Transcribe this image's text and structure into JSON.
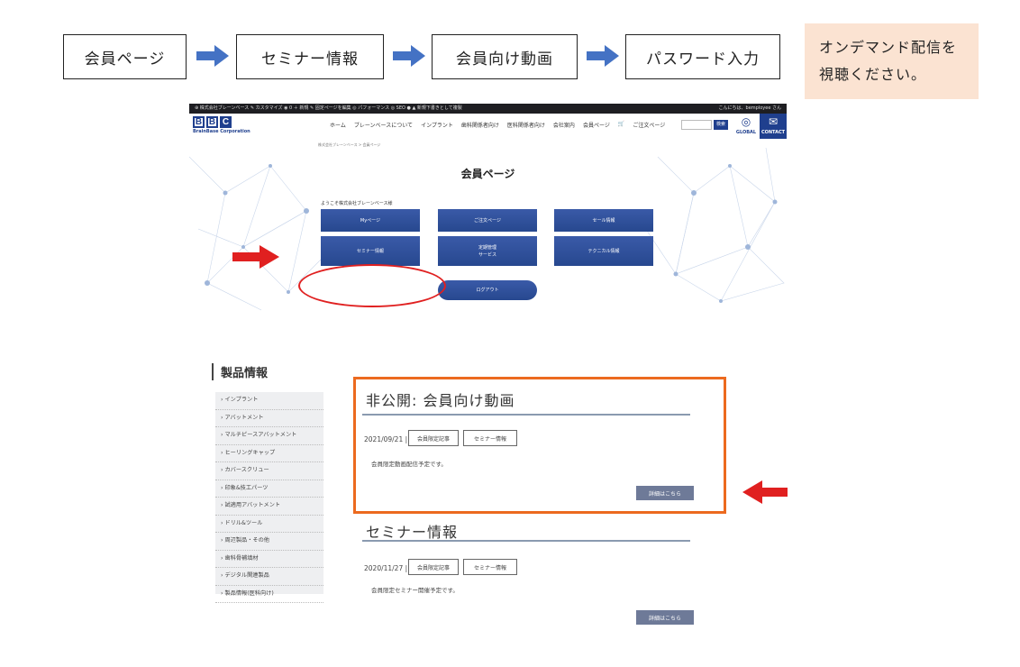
{
  "flow": {
    "steps": [
      "会員ページ",
      "セミナー情報",
      "会員向け動画",
      "パスワード入力"
    ],
    "note": [
      "オンデマンド配信を",
      "視聴ください。"
    ]
  },
  "site": {
    "adminbar_left": "⊕ 株式会社ブレーンベース ✎ カスタマイズ ◉ 0 ＋ 新規 ✎ 固定ページを編集 ◎ パフォーマンス ◎ SEO ● ▲ 新規下書きとして複製",
    "adminbar_right": "こんにちは、bemployee さん",
    "logo_letters": [
      "B",
      "B",
      "C"
    ],
    "logo_sub": "BrainBase Corporation",
    "nav": [
      "ホーム",
      "ブレーンベースについて",
      "インプラント",
      "歯科関係者向け",
      "医科関係者向け",
      "会社案内",
      "会員ページ",
      "ご注文ページ"
    ],
    "search_button": "検索",
    "global_label": "GLOBAL",
    "contact_label": "CONTACT",
    "breadcrumb": "株式会社ブレーンベース > 会員ページ",
    "title": "会員ページ",
    "welcome": "ようこそ株式会社ブレーンベース様",
    "buttons": {
      "mypage": "Myページ",
      "order": "ご注文ページ",
      "sale": "セール情報",
      "seminar": "セミナー情報",
      "repair_line1": "定期管理",
      "repair_line2": "サービス",
      "technical": "テクニカル情報",
      "logout": "ログアウト"
    }
  },
  "product": {
    "heading": "製品情報",
    "sidebar": [
      "インプラント",
      "アバットメント",
      "マルチピースアバットメント",
      "ヒーリングキャップ",
      "カバースクリュー",
      "印象&技工パーツ",
      "試適用アバットメント",
      "ドリル&ツール",
      "周辺製品・その他",
      "歯科骨補填材",
      "デジタル関連製品",
      "製品情報(医科向け)"
    ],
    "posts": [
      {
        "title": "非公開: 会員向け動画",
        "date": "2021/09/21 |",
        "tags": [
          "会員限定記事",
          "セミナー情報"
        ],
        "body": "会員限定動画配信予定です。",
        "more": "詳細はこちら"
      },
      {
        "title": "セミナー情報",
        "date": "2020/11/27 |",
        "tags": [
          "会員限定記事",
          "セミナー情報"
        ],
        "body": "会員限定セミナー開催予定です。",
        "more": "詳細はこちら"
      }
    ]
  },
  "colors": {
    "accent_blue": "#1f3f8e",
    "highlight_orange": "#ec6a1f",
    "pointer_red": "#e02020",
    "note_bg": "#fbe3d2",
    "flow_arrow": "#4472c4"
  }
}
